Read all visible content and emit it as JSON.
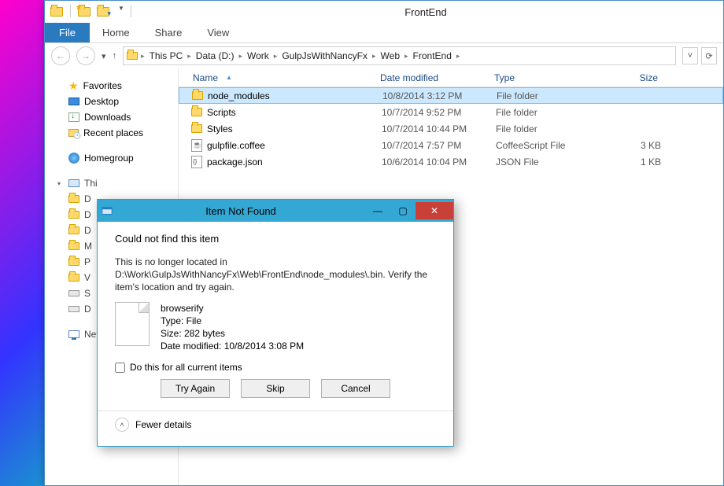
{
  "window": {
    "title": "FrontEnd"
  },
  "ribbon": {
    "file": "File",
    "tabs": [
      "Home",
      "Share",
      "View"
    ]
  },
  "breadcrumb": [
    "This PC",
    "Data (D:)",
    "Work",
    "GulpJsWithNancyFx",
    "Web",
    "FrontEnd"
  ],
  "sidebar": {
    "favorites": {
      "label": "Favorites",
      "items": [
        "Desktop",
        "Downloads",
        "Recent places"
      ]
    },
    "homegroup": {
      "label": "Homegroup"
    },
    "thispc": {
      "label": "Thi",
      "drives": [
        "D",
        "D",
        "D",
        "M",
        "P",
        "V",
        "S",
        "D"
      ]
    },
    "network": {
      "label": "Net"
    }
  },
  "columns": {
    "name": "Name",
    "date": "Date modified",
    "type": "Type",
    "size": "Size"
  },
  "files": [
    {
      "name": "node_modules",
      "date": "10/8/2014 3:12 PM",
      "type": "File folder",
      "size": "",
      "icon": "folder",
      "selected": true
    },
    {
      "name": "Scripts",
      "date": "10/7/2014 9:52 PM",
      "type": "File folder",
      "size": "",
      "icon": "folder"
    },
    {
      "name": "Styles",
      "date": "10/7/2014 10:44 PM",
      "type": "File folder",
      "size": "",
      "icon": "folder"
    },
    {
      "name": "gulpfile.coffee",
      "date": "10/7/2014 7:57 PM",
      "type": "CoffeeScript File",
      "size": "3 KB",
      "icon": "coffee"
    },
    {
      "name": "package.json",
      "date": "10/6/2014 10:04 PM",
      "type": "JSON File",
      "size": "1 KB",
      "icon": "json"
    }
  ],
  "dialog": {
    "title": "Item Not Found",
    "heading": "Could not find this item",
    "message": "This is no longer located in D:\\Work\\GulpJsWithNancyFx\\Web\\FrontEnd\\node_modules\\.bin. Verify the item's location and try again.",
    "file": {
      "name": "browserify",
      "type_line": "Type: File",
      "size_line": "Size: 282 bytes",
      "date_line": "Date modified: 10/8/2014 3:08 PM"
    },
    "checkbox": "Do this for all current items",
    "buttons": {
      "try_again": "Try Again",
      "skip": "Skip",
      "cancel": "Cancel"
    },
    "fewer": "Fewer details"
  }
}
